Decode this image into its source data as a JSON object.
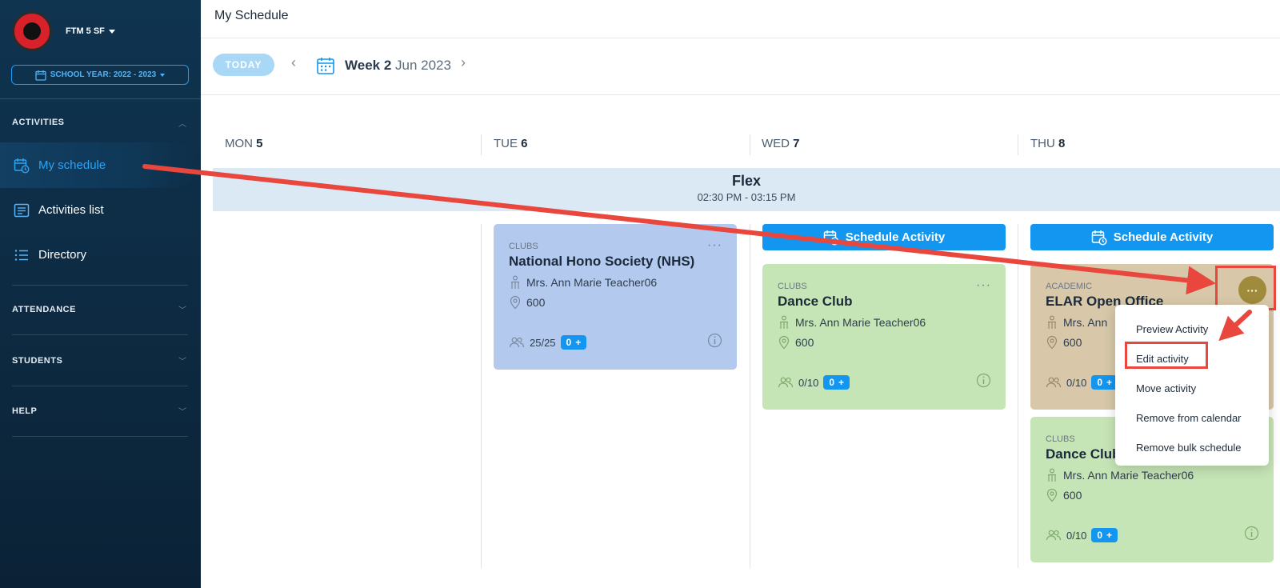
{
  "sidebar": {
    "org_name": "FTM 5 SF",
    "school_year": "SCHOOL YEAR: 2022 - 2023",
    "sections": {
      "activities": "ACTIVITIES",
      "attendance": "ATTENDANCE",
      "students": "STUDENTS",
      "help": "HELP"
    },
    "items": [
      {
        "label": "My schedule",
        "icon": "calendar-clock-icon",
        "active": true
      },
      {
        "label": "Activities list",
        "icon": "list-board-icon",
        "active": false
      },
      {
        "label": "Directory",
        "icon": "list-icon",
        "active": false
      }
    ]
  },
  "header": {
    "title": "My Schedule",
    "today_label": "TODAY",
    "week_bold": "Week 2",
    "week_month": "Jun 2023"
  },
  "days": [
    {
      "name": "MON",
      "num": "5"
    },
    {
      "name": "TUE",
      "num": "6"
    },
    {
      "name": "WED",
      "num": "7"
    },
    {
      "name": "THU",
      "num": "8"
    }
  ],
  "flex_period": {
    "title": "Flex",
    "time": "02:30 PM - 03:15 PM"
  },
  "schedule_label": "Schedule Activity",
  "cards": {
    "nhs": {
      "category": "CLUBS",
      "title": "National Hono Society (NHS)",
      "teacher": "Mrs. Ann Marie Teacher06",
      "room": "600",
      "count": "25/25",
      "pill": "0"
    },
    "dance_wed": {
      "category": "CLUBS",
      "title": "Dance Club",
      "teacher": "Mrs. Ann Marie Teacher06",
      "room": "600",
      "count": "0/10",
      "pill": "0"
    },
    "elar": {
      "category": "ACADEMIC",
      "title": "ELAR Open Office",
      "teacher": "Mrs. Ann",
      "room": "600",
      "count": "0/10",
      "pill": "0"
    },
    "dance_thu": {
      "category": "CLUBS",
      "title": "Dance Club",
      "teacher": "Mrs. Ann Marie Teacher06",
      "room": "600",
      "count": "0/10",
      "pill": "0"
    }
  },
  "context_menu": {
    "items": [
      "Preview Activity",
      "Edit activity",
      "Move activity",
      "Remove from calendar",
      "Remove bulk schedule"
    ]
  },
  "colors": {
    "accent": "#1296f0",
    "annotation": "#e9473d",
    "sidebar_bg": "#0f3450"
  }
}
